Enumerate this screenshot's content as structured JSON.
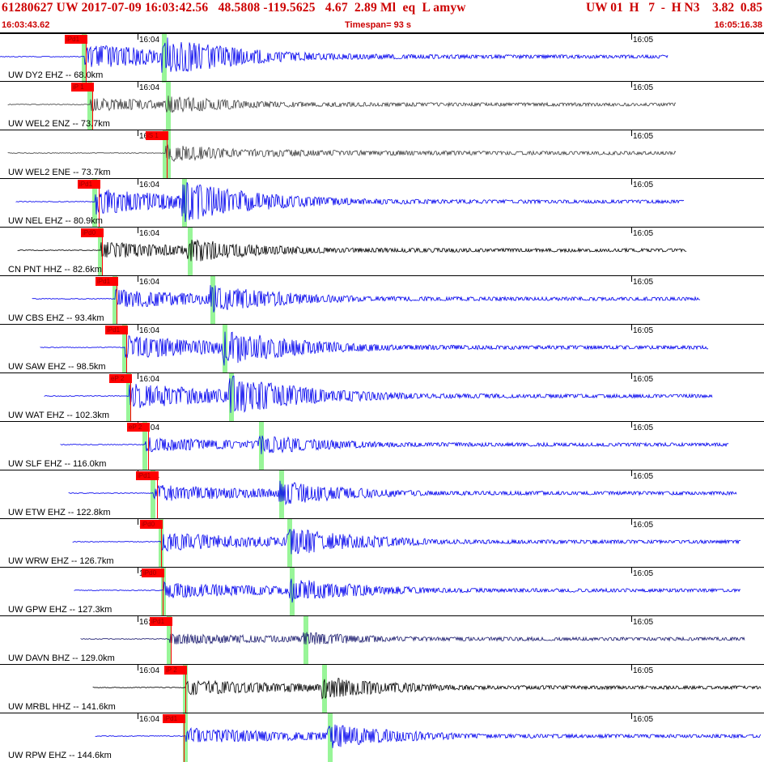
{
  "header": {
    "title": "61280627 UW 2017-07-09 16:03:42.56   48.5808 -119.5625   4.67  2.89 Ml  eq  L amyw",
    "params": "UW 01  H   7  -  H N3    3.82  0.85",
    "start_time": "16:03:43.62",
    "timespan": "Timespan=  93 s",
    "end_time": "16:05:16.38"
  },
  "time_labels": {
    "t1": "16:04",
    "t2": "16:05"
  },
  "colors": {
    "blue": "#0000ee",
    "gray": "#404040",
    "black": "#000000",
    "navy": "#1a1a6e",
    "pick": "#ff0000",
    "green": "#98f598"
  },
  "traces": [
    {
      "label": "UW DY2 EHZ -- 68.0km",
      "pick": "iPd1",
      "color": "blue",
      "amp": 1.0
    },
    {
      "label": "UW WEL2 ENZ -- 73.7km",
      "pick": "iP 1",
      "color": "gray",
      "amp": 0.45
    },
    {
      "label": "UW WEL2 ENE -- 73.7km",
      "pick": "iS 1",
      "color": "gray",
      "amp": 0.45
    },
    {
      "label": "UW NEL EHZ -- 80.9km",
      "pick": "iPd1",
      "color": "blue",
      "amp": 1.0
    },
    {
      "label": "CN PNT HHZ -- 82.6km",
      "pick": "iPd0",
      "color": "black",
      "amp": 0.6
    },
    {
      "label": "UW CBS EHZ -- 93.4km",
      "pick": "iPd1",
      "color": "blue",
      "amp": 0.7
    },
    {
      "label": "UW SAW EHZ -- 98.5km",
      "pick": "iPd1",
      "color": "blue",
      "amp": 0.9
    },
    {
      "label": "UW WAT EHZ -- 102.3km",
      "pick": "eP 2",
      "color": "blue",
      "amp": 1.0
    },
    {
      "label": "UW SLF EHZ -- 116.0km",
      "pick": "eP 2",
      "color": "blue",
      "amp": 0.5
    },
    {
      "label": "UW ETW EHZ -- 122.8km",
      "pick": "iPd1",
      "color": "blue",
      "amp": 0.6
    },
    {
      "label": "UW WRW EHZ -- 126.7km",
      "pick": "iPd0",
      "color": "blue",
      "amp": 0.7
    },
    {
      "label": "UW GPW EHZ -- 127.3km",
      "pick": "iPd0",
      "color": "blue",
      "amp": 0.6
    },
    {
      "label": "UW DAVN BHZ -- 129.0km",
      "pick": "iPd1",
      "color": "navy",
      "amp": 0.35
    },
    {
      "label": "UW MRBL HHZ -- 141.6km",
      "pick": "iP 2",
      "color": "black",
      "amp": 0.55
    },
    {
      "label": "UW RPW EHZ -- 144.6km",
      "pick": "iPd1",
      "color": "blue",
      "amp": 0.6
    }
  ]
}
